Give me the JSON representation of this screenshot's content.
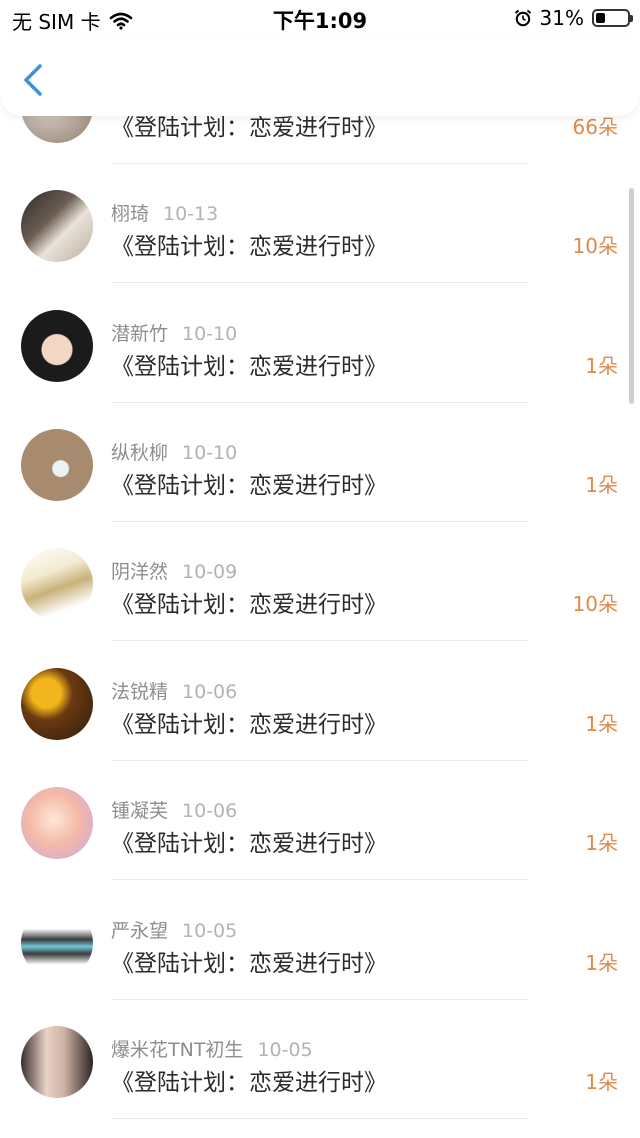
{
  "status_bar": {
    "carrier": "无 SIM 卡",
    "time": "下午1:09",
    "battery": "31%",
    "battery_level": 0.31
  },
  "nav": {
    "back_icon": "chevron-left-icon"
  },
  "items": [
    {
      "name": "",
      "date": "",
      "title": "《登陆计划：恋爱进行时》",
      "count": "66朵"
    },
    {
      "name": "栩琦",
      "date": "10-13",
      "title": "《登陆计划：恋爱进行时》",
      "count": "10朵"
    },
    {
      "name": "潜新竹",
      "date": "10-10",
      "title": "《登陆计划：恋爱进行时》",
      "count": "1朵"
    },
    {
      "name": "纵秋柳",
      "date": "10-10",
      "title": "《登陆计划：恋爱进行时》",
      "count": "1朵"
    },
    {
      "name": "阴洋然",
      "date": "10-09",
      "title": "《登陆计划：恋爱进行时》",
      "count": "10朵"
    },
    {
      "name": "法锐精",
      "date": "10-06",
      "title": "《登陆计划：恋爱进行时》",
      "count": "1朵"
    },
    {
      "name": "锺凝芙",
      "date": "10-06",
      "title": "《登陆计划：恋爱进行时》",
      "count": "1朵"
    },
    {
      "name": "严永望",
      "date": "10-05",
      "title": "《登陆计划：恋爱进行时》",
      "count": "1朵"
    },
    {
      "name": "爆米花TNT初生",
      "date": "10-05",
      "title": "《登陆计划：恋爱进行时》",
      "count": "1朵"
    }
  ],
  "colors": {
    "accent": "#e08a4a",
    "back": "#3d8fe0"
  }
}
